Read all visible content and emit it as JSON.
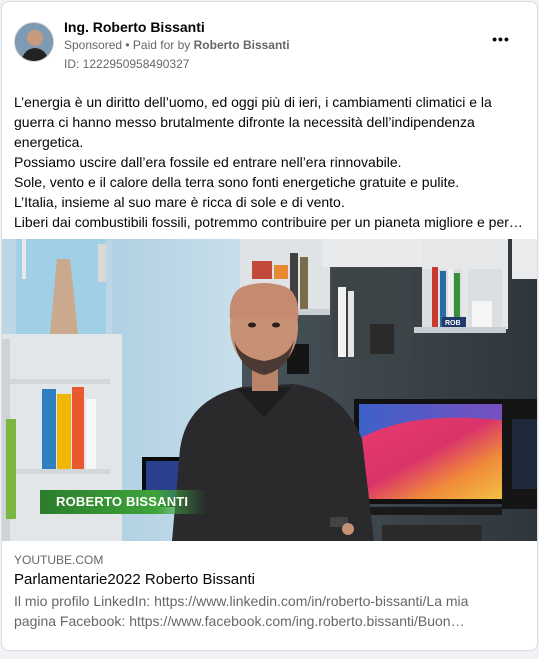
{
  "post": {
    "author": "Ing. Roberto Bissanti",
    "sponsored_label": "Sponsored",
    "paid_for_prefix": " • Paid for by ",
    "paid_for_name": "Roberto Bissanti",
    "ad_id": "ID: 1222950958490327",
    "more_label": "•••",
    "text_lines": [
      "L’energia è un diritto dell’uomo, ed oggi più di ieri, i cambiamenti climatici e la",
      "guerra ci hanno messo brutalmente difronte la necessità dell’indipendenza",
      "energetica.",
      "Possiamo uscire dall’era fossile ed entrare nell’era rinnovabile.",
      "Sole, vento e il calore della terra sono fonti energetiche gratuite e pulite.",
      "L’Italia, insieme al suo mare è ricca di sole e di vento.",
      "Liberi dai combustibili fossili, potremmo contribuire per un pianeta migliore e per…"
    ]
  },
  "video": {
    "banner_text": "ROBERTO BISSANTI",
    "book_label": "ROB"
  },
  "link": {
    "domain": "YOUTUBE.COM",
    "title": "Parlamentarie2022 Roberto Bissanti",
    "description_lines": [
      "Il mio profilo LinkedIn: https://www.linkedin.com/in/roberto-bissanti/La mia",
      "pagina Facebook: https://www.facebook.com/ing.roberto.bissanti/Buon…"
    ]
  },
  "colors": {
    "background": "#f0f2f5",
    "card": "#ffffff",
    "secondary_text": "#65676b",
    "banner_green": "#3ea33b"
  }
}
